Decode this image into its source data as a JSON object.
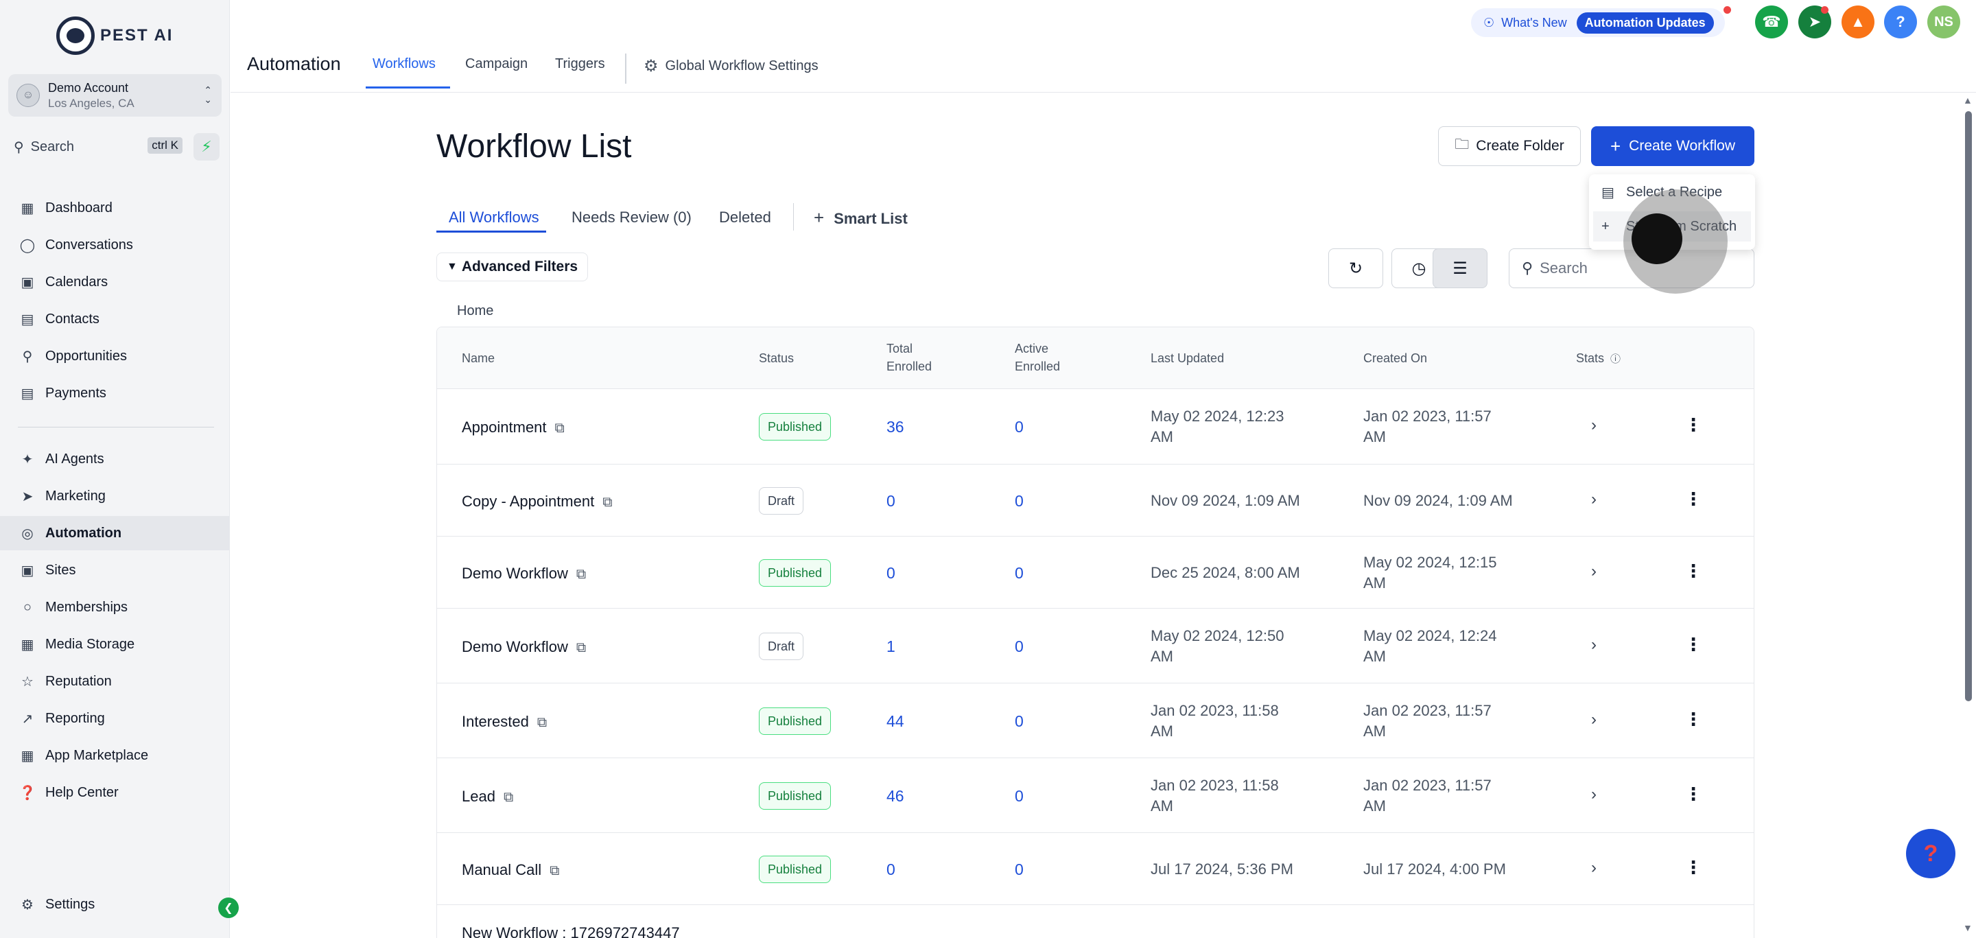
{
  "sidebar": {
    "logo_text": "PEST AI",
    "account": {
      "name": "Demo Account",
      "location": "Los Angeles, CA"
    },
    "search": {
      "placeholder": "Search",
      "shortcut": "ctrl K"
    },
    "nav": [
      {
        "label": "Dashboard",
        "icon": "dashboard-icon"
      },
      {
        "label": "Conversations",
        "icon": "chat-icon"
      },
      {
        "label": "Calendars",
        "icon": "calendar-icon"
      },
      {
        "label": "Contacts",
        "icon": "contacts-icon"
      },
      {
        "label": "Opportunities",
        "icon": "funnel-icon"
      },
      {
        "label": "Payments",
        "icon": "receipt-icon"
      },
      {
        "label": "AI Agents",
        "icon": "sparkle-icon"
      },
      {
        "label": "Marketing",
        "icon": "send-icon"
      },
      {
        "label": "Automation",
        "icon": "automation-icon",
        "active": true
      },
      {
        "label": "Sites",
        "icon": "sites-icon"
      },
      {
        "label": "Memberships",
        "icon": "badge-icon"
      },
      {
        "label": "Media Storage",
        "icon": "image-icon"
      },
      {
        "label": "Reputation",
        "icon": "star-icon"
      },
      {
        "label": "Reporting",
        "icon": "chart-line-icon"
      },
      {
        "label": "App Marketplace",
        "icon": "grid-icon"
      },
      {
        "label": "Help Center",
        "icon": "help-icon"
      }
    ],
    "settings_label": "Settings"
  },
  "topbar": {
    "title": "Automation",
    "tabs": [
      "Workflows",
      "Campaign",
      "Triggers"
    ],
    "global_settings": "Global Workflow Settings",
    "whats_new": "What's New",
    "updates_badge": "Automation Updates",
    "avatar_initials": "NS",
    "colors": {
      "phone": "#16a34a",
      "megaphone": "#15803d",
      "bell": "#f97316",
      "help": "#3b82f6",
      "avatar": "#86c46a"
    }
  },
  "main": {
    "title": "Workflow List",
    "create_folder": "Create Folder",
    "create_workflow": "Create Workflow",
    "menu": [
      "Select a Recipe",
      "Start from Scratch"
    ],
    "subtabs": [
      "All Workflows",
      "Needs Review (0)",
      "Deleted"
    ],
    "smart_list": "Smart List",
    "advanced_filters": "Advanced Filters",
    "search_placeholder": "Search",
    "breadcrumb": "Home",
    "columns": [
      "Name",
      "Status",
      "Total Enrolled",
      "Active Enrolled",
      "Last Updated",
      "Created On",
      "Stats"
    ],
    "rows": [
      {
        "name": "Appointment",
        "status": "Published",
        "total": "36",
        "active": "0",
        "updated": [
          "May 02 2024, 12:23",
          "AM"
        ],
        "created": [
          "Jan 02 2023, 11:57",
          "AM"
        ]
      },
      {
        "name": "Copy - Appointment",
        "status": "Draft",
        "total": "0",
        "active": "0",
        "updated": [
          "Nov 09 2024, 1:09 AM",
          ""
        ],
        "created": [
          "Nov 09 2024, 1:09 AM",
          ""
        ]
      },
      {
        "name": "Demo Workflow",
        "status": "Published",
        "total": "0",
        "active": "0",
        "updated": [
          "Dec 25 2024, 8:00 AM",
          ""
        ],
        "created": [
          "May 02 2024, 12:15",
          "AM"
        ]
      },
      {
        "name": "Demo Workflow",
        "status": "Draft",
        "total": "1",
        "active": "0",
        "updated": [
          "May 02 2024, 12:50",
          "AM"
        ],
        "created": [
          "May 02 2024, 12:24",
          "AM"
        ]
      },
      {
        "name": "Interested",
        "status": "Published",
        "total": "44",
        "active": "0",
        "updated": [
          "Jan 02 2023, 11:58",
          "AM"
        ],
        "created": [
          "Jan 02 2023, 11:57",
          "AM"
        ]
      },
      {
        "name": "Lead",
        "status": "Published",
        "total": "46",
        "active": "0",
        "updated": [
          "Jan 02 2023, 11:58",
          "AM"
        ],
        "created": [
          "Jan 02 2023, 11:57",
          "AM"
        ]
      },
      {
        "name": "Manual Call",
        "status": "Published",
        "total": "0",
        "active": "0",
        "updated": [
          "Jul 17 2024, 5:36 PM",
          ""
        ],
        "created": [
          "Jul 17 2024, 4:00 PM",
          ""
        ]
      },
      {
        "name": "New Workflow : 1726972743447",
        "status": "",
        "total": "",
        "active": "",
        "updated": [
          "",
          ""
        ],
        "created": [
          "",
          ""
        ]
      }
    ]
  }
}
